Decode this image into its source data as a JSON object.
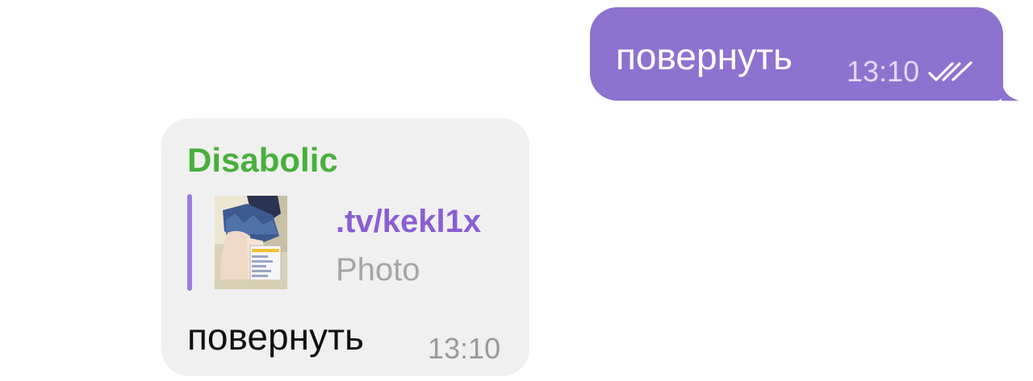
{
  "outgoing_message": {
    "text": "повернуть",
    "time": "13:10",
    "status_icon": "double-check-icon",
    "bubble_color": "#8e72cf"
  },
  "incoming_message": {
    "sender": "Disabolic",
    "sender_color": "#48b03c",
    "reply": {
      "title": ".tv/kekl1x",
      "subtitle": "Photo",
      "accent_color": "#9b7be0"
    },
    "text": "повернуть",
    "time": "13:10",
    "bubble_color": "#f0f0f0"
  }
}
